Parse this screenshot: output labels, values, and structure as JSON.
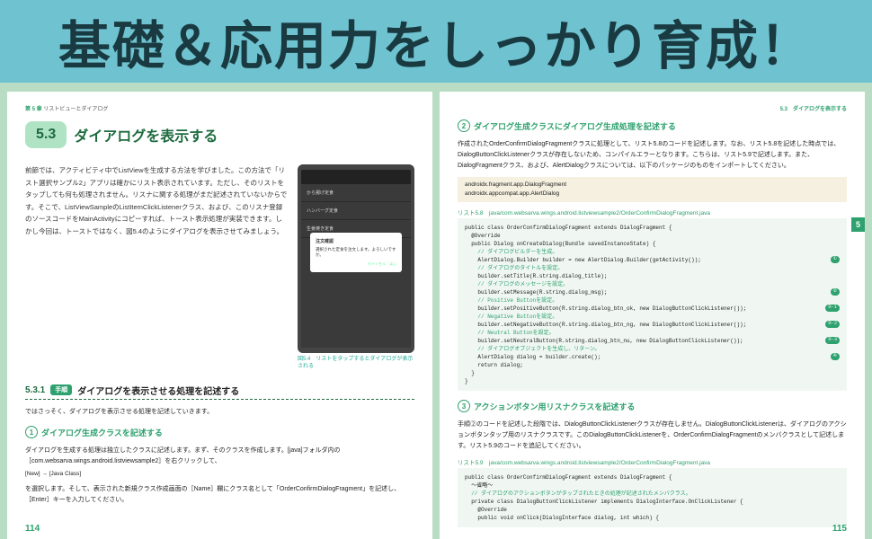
{
  "banner": {
    "text": "基礎＆応用力をしっかり育成！"
  },
  "left_page": {
    "header_left_ch": "第 5 章",
    "header_left_title": "リストビューとダイアログ",
    "section_num": "5.3",
    "section_title": "ダイアログを表示する",
    "intro": "前節では、アクティビティ中でListViewを生成する方法を学びました。この方法で「リスト選択サンプル2」アプリは確かにリスト表示されています。ただし、そのリストをタップしても何も処理されません。リスナに関する処理がまだ記述されていないからです。そこで、ListViewSampleのListItemClickListenerクラス、および、このリスナ登録のソースコードをMainActivityにコピーすれば、トースト表示処理が実装できます。しかし今回は、トーストではなく、図5.4のようにダイアログを表示させてみましょう。",
    "phone": {
      "items": [
        "から揚げ定食",
        "ハンバーグ定食",
        "生姜焼き定食"
      ],
      "dialog_title": "注文確認",
      "dialog_msg": "選択された定食を注文します。よろしいですか。",
      "dialog_actions": "キャンセル　はい"
    },
    "phone_caption": "図5.4　リストをタップするとダイアログが表示される",
    "sub_num": "5.3.1",
    "sub_badge": "手順",
    "sub_title": "ダイアログを表示させる処理を記述する",
    "sub_intro": "ではさっそく、ダイアログを表示させる処理を記述していきます。",
    "step1_title": "ダイアログ生成クラスを記述する",
    "step1_body": "ダイアログを生成する処理は独立したクラスに記述します。まず、そのクラスを作成します。[java]フォルダ内の［com.websarva.wings.android.listviewsample2］を右クリックして、",
    "step1_path": "[New] → [Java Class]",
    "step1_body2": "を選択します。そして、表示された新規クラス作成画面の［Name］欄にクラス名として「OrderConfirmDialogFragment」を記述し、［Enter］キーを入力してください。",
    "page_num": "114"
  },
  "right_page": {
    "header_right": "5.3　ダイアログを表示する",
    "step2_title": "ダイアログ生成クラスにダイアログ生成処理を記述する",
    "step2_body": "作成されたOrderConfirmDialogFragmentクラスに処理として、リスト5.8のコードを記述します。なお、リスト5.8を記述した時点では、DialogButtonClickListenerクラスが存在しないため、コンパイルエラーとなります。こちらは、リスト5.9で記述します。また、DialogFragmentクラス、および、AlertDialogクラスについては、以下のパッケージのものをインポートしてください。",
    "pkg_lines": "androidx.fragment.app.DialogFragment\nandroidx.appcompat.app.AlertDialog",
    "code58_caption": "リスト5.8　java/com.websarva.wings.android.listviewsample2/OrderConfirmDialogFragment.java",
    "step3_title": "アクションボタン用リスナクラスを記述する",
    "step3_body": "手順②のコードを記述した段階では、DialogButtonClickListenerクラスが存在しません。DialogButtonClickListenerは、ダイアログのアクションボタンタップ用のリスナクラスです。このDialogButtonClickListenerを、OrderConfirmDialogFragmentのメンバクラスとして記述します。リスト5.9のコードを追記してください。",
    "code59_caption": "リスト5.9　java/com.websarva.wings.android.listviewsample2/OrderConfirmDialogFragment.java",
    "page_num": "115",
    "tab": "5"
  }
}
